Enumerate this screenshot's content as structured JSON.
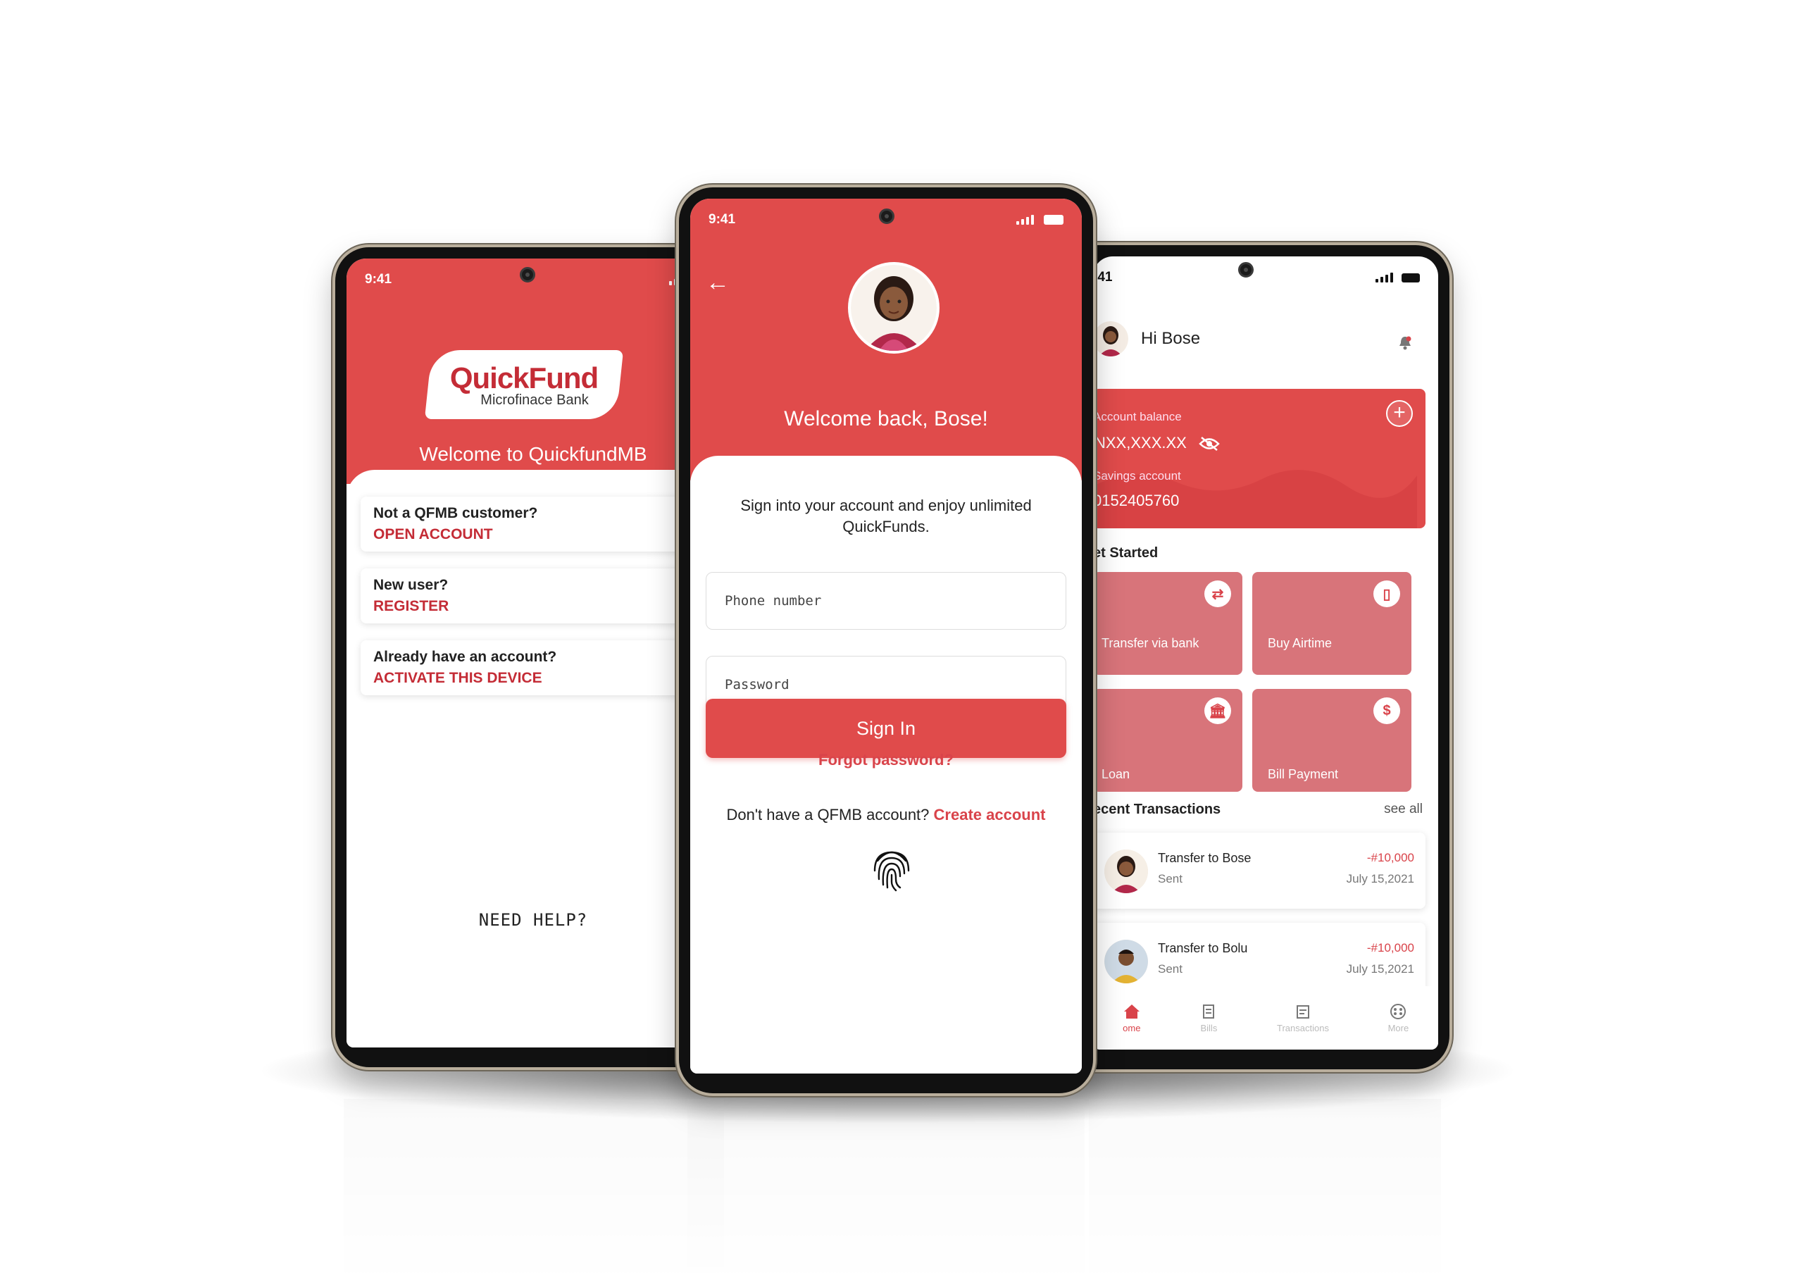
{
  "left_phone": {
    "time": "9:41",
    "logo_name": "QuickFund",
    "logo_sub": "Microfinace Bank",
    "welcome": "Welcome to QuickfundMB",
    "options": [
      {
        "question": "Not a QFMB customer?",
        "action": "OPEN ACCOUNT"
      },
      {
        "question": "New user?",
        "action": "REGISTER"
      },
      {
        "question": "Already have an account?",
        "action": "ACTIVATE THIS DEVICE"
      }
    ],
    "help": "NEED HELP?"
  },
  "center_phone": {
    "time": "9:41",
    "welcome": "Welcome back, Bose!",
    "intro": "Sign into your account and enjoy unlimited QuickFunds.",
    "phone_placeholder": "Phone number",
    "password_placeholder": "Password",
    "signin": "Sign In",
    "forgot": "Forgot password?",
    "no_account": "Don't have a QFMB account?",
    "create": "Create account"
  },
  "right_phone": {
    "time": ":41",
    "greeting": "Hi Bose",
    "account_balance_label": "Account balance",
    "account_balance": "NXX,XXX.XX",
    "savings_label": "Savings account",
    "savings_number": "0152405760",
    "get_started": "et Started",
    "tiles": [
      "Transfer via bank",
      "Buy Airtime",
      "Loan",
      "Bill Payment"
    ],
    "recent": "ecent Transactions",
    "see_all": "see all",
    "transactions": [
      {
        "title": "Transfer to Bose",
        "status": "Sent",
        "amount": "-#10,000",
        "date": "July 15,2021"
      },
      {
        "title": "Transfer to Bolu",
        "status": "Sent",
        "amount": "-#10,000",
        "date": "July 15,2021"
      }
    ],
    "nav": [
      "ome",
      "Bills",
      "Transactions",
      "More"
    ]
  },
  "colors": {
    "brand_red": "#e04b4b",
    "accent_red": "#c42c36",
    "tile_red": "#d8747a"
  }
}
